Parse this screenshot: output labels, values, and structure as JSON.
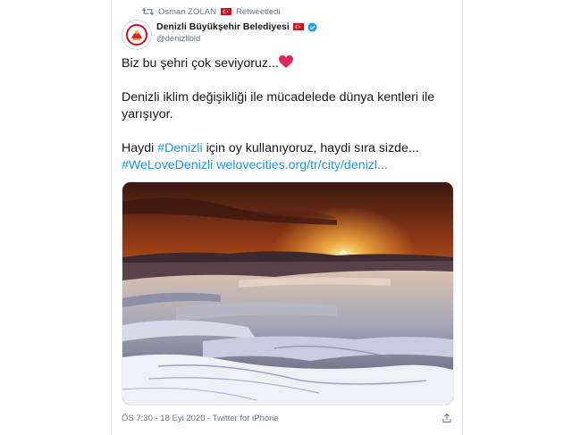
{
  "retweet": {
    "user": "Osman ZOLAN",
    "label": "Retweetledi",
    "icon": "retweet-icon"
  },
  "author": {
    "name": "Denizli Büyükşehir Belediyesi",
    "handle": "@denizlibld",
    "verified": true
  },
  "tweet": {
    "line1": "Biz bu şehri çok seviyoruz...",
    "line2": "Denizli iklim değişikliği ile mücadelede dünya kentleri ile yarışıyor.",
    "line3_prefix": "Haydi ",
    "line3_hashtag": "#Denizli",
    "line3_suffix": " için oy kullanıyoruz, haydi sıra sizde...",
    "line4_hashtag": "#WeLoveDenizli",
    "line4_link": "welovecities.org/tr/city/denizl..."
  },
  "meta": {
    "time": "ÖS 7:30 - 18 Eyl 2020 - Twitter for iPhone"
  },
  "colors": {
    "link": "#1b95e0",
    "secondary": "#657786",
    "heart": "#e0245e",
    "verified": "#1da1f2"
  }
}
